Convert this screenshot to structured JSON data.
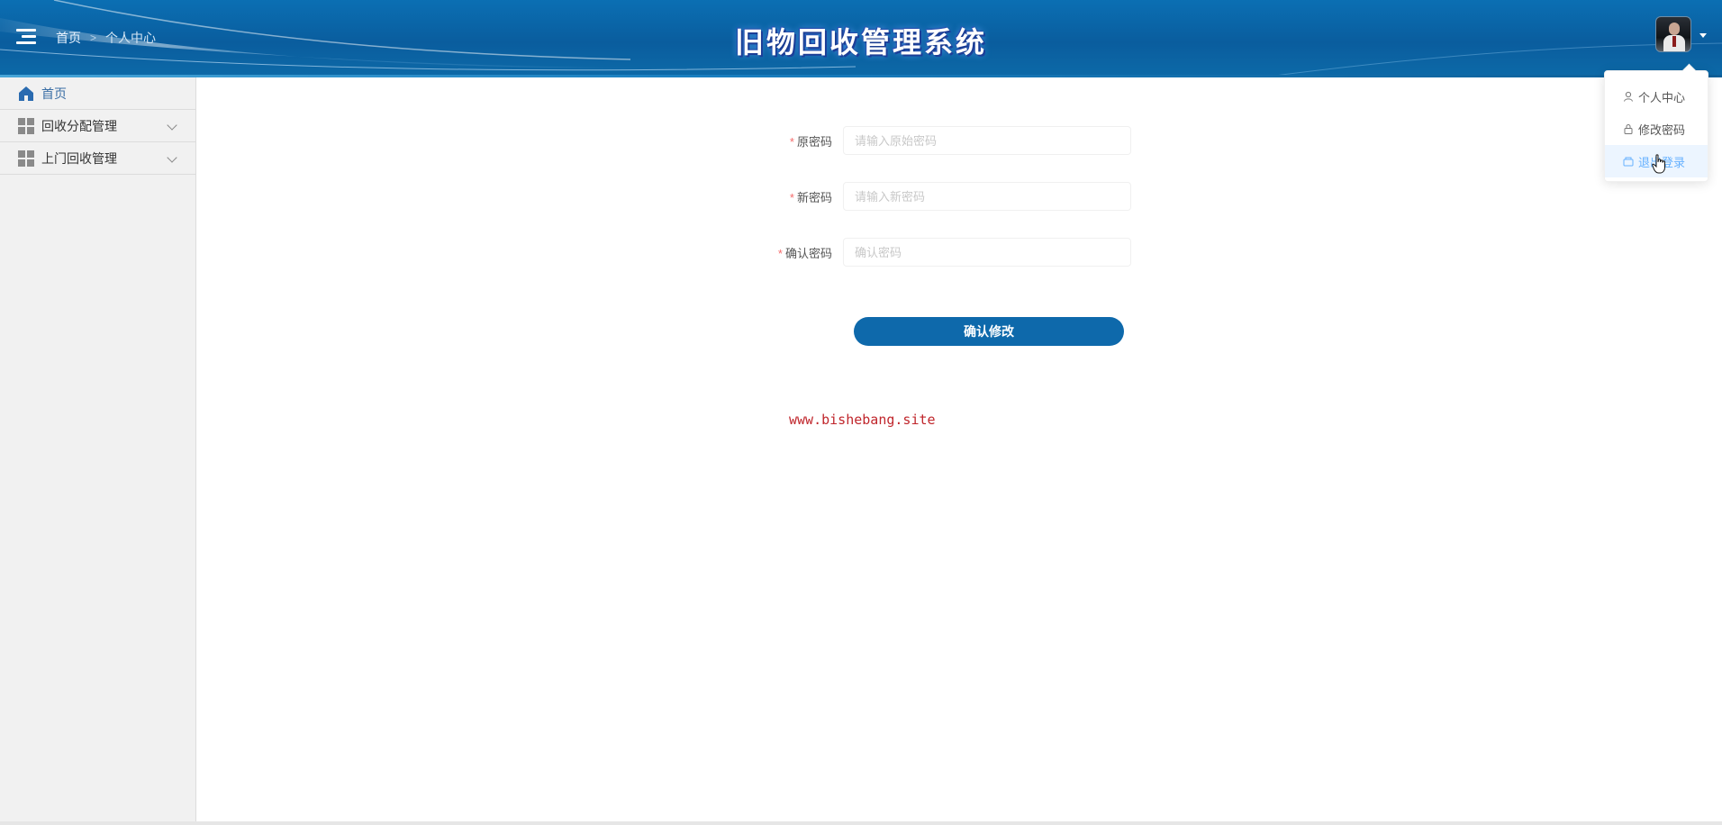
{
  "header": {
    "title": "旧物回收管理系统",
    "breadcrumb": [
      "首页",
      "个人中心"
    ],
    "avatar_icon": "user-avatar-icon"
  },
  "sidebar": {
    "items": [
      {
        "label": "首页",
        "icon": "home-icon",
        "active": true
      },
      {
        "label": "回收分配管理",
        "icon": "grid-icon",
        "expandable": true
      },
      {
        "label": "上门回收管理",
        "icon": "grid-icon",
        "expandable": true
      }
    ]
  },
  "form": {
    "old_password": {
      "label": "原密码",
      "placeholder": "请输入原始密码",
      "value": ""
    },
    "new_password": {
      "label": "新密码",
      "placeholder": "请输入新密码",
      "value": ""
    },
    "confirm_password": {
      "label": "确认密码",
      "placeholder": "确认密码",
      "value": ""
    },
    "required_mark": "*",
    "submit_label": "确认修改"
  },
  "watermark": "www.bishebang.site",
  "dropdown": {
    "items": [
      {
        "label": "个人中心",
        "icon": "user-icon"
      },
      {
        "label": "修改密码",
        "icon": "lock-icon"
      },
      {
        "label": "退出登录",
        "icon": "logout-icon",
        "hovered": true
      }
    ]
  },
  "colors": {
    "header_bg": "#0a5d9e",
    "accent": "#0e69ab",
    "required": "#f56c6c",
    "hover_text": "#66b1ff",
    "watermark": "#c0262c"
  }
}
